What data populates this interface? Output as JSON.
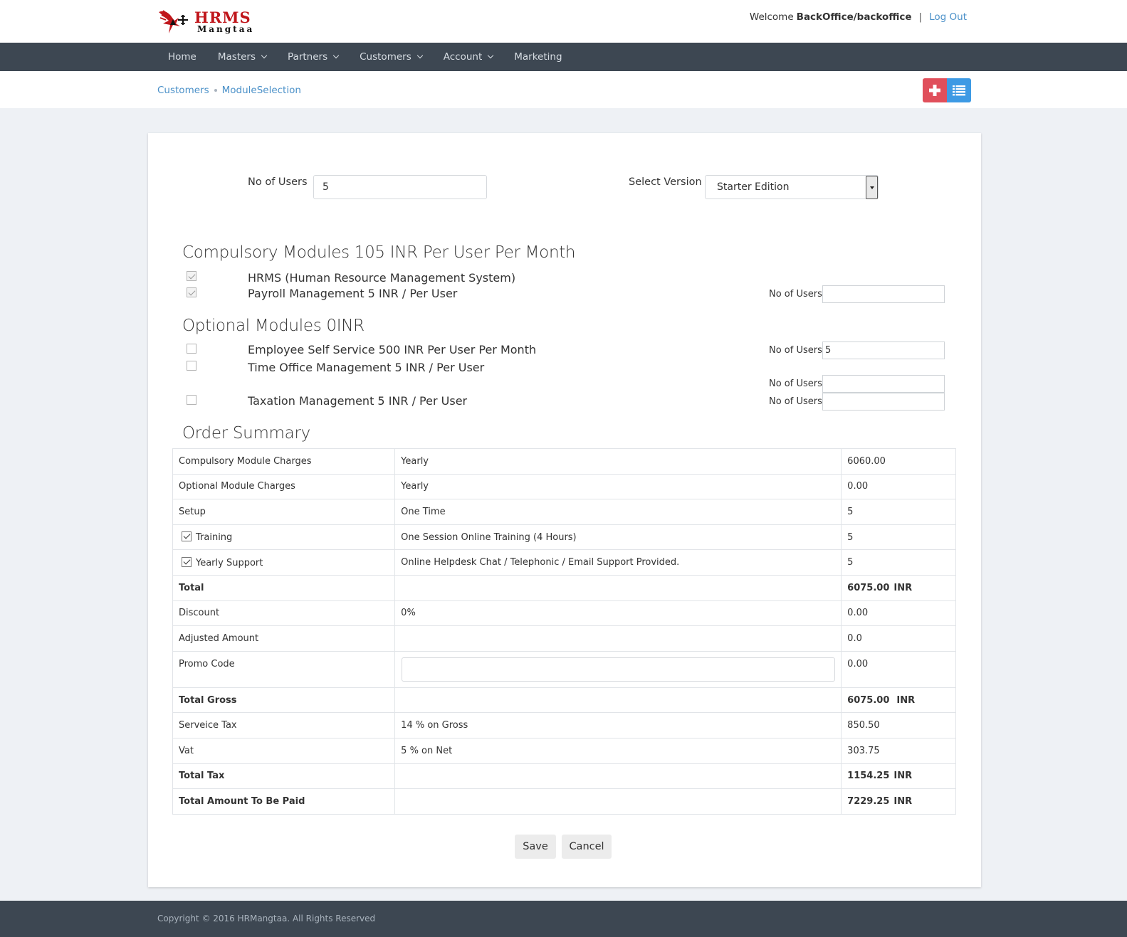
{
  "header": {
    "brand_top": "HRMS",
    "brand_bottom": "Mangtaa",
    "welcome_label": "Welcome",
    "username": "BackOffice/backoffice",
    "separator": "|",
    "logout": "Log Out"
  },
  "nav": {
    "items": [
      {
        "label": "Home"
      },
      {
        "label": "Masters"
      },
      {
        "label": "Partners"
      },
      {
        "label": "Customers"
      },
      {
        "label": "Account"
      },
      {
        "label": "Marketing"
      }
    ]
  },
  "breadcrumb": {
    "items": [
      "Customers",
      "ModuleSelection"
    ]
  },
  "form": {
    "users_label": "No of Users",
    "users_value": "5",
    "version_label": "Select Version",
    "version_value": "Starter Edition"
  },
  "compulsory": {
    "heading": "Compulsory Modules 105 INR Per User Per Month",
    "modules": [
      {
        "name": "HRMS (Human Resource Management System)",
        "checked": true
      },
      {
        "name": "Payroll Management 5 INR / Per User",
        "checked": true,
        "users_label": "No of Users",
        "users_value": ""
      }
    ]
  },
  "optional": {
    "heading": "Optional Modules 0INR",
    "modules": [
      {
        "name": "Employee Self Service 500 INR Per User Per Month",
        "checked": false,
        "users_label": "No of Users",
        "users_value": "5"
      },
      {
        "name": "Time Office Management 5 INR / Per User",
        "checked": false,
        "users_label": "No of Users",
        "users_value": ""
      },
      {
        "name": "Taxation Management 5 INR / Per User",
        "checked": false,
        "users_label": "No of Users",
        "users_value": ""
      }
    ]
  },
  "summary": {
    "heading": "Order Summary",
    "rows": [
      {
        "label": "Compulsory Module Charges",
        "detail": "Yearly",
        "amount": "6060.00"
      },
      {
        "label": "Optional Module Charges",
        "detail": "Yearly",
        "amount": "0.00"
      },
      {
        "label": "Setup",
        "detail": "One Time",
        "amount": "5"
      },
      {
        "label": "Training",
        "detail": "One Session Online Training (4 Hours)",
        "amount": "5"
      },
      {
        "label": "Yearly Support",
        "detail": "Online Helpdesk Chat / Telephonic / Email Support Provided.",
        "amount": "5"
      },
      {
        "label": "Total",
        "detail": "",
        "amount": "6075.00",
        "unit": "INR"
      },
      {
        "label": "Discount",
        "detail": "0%",
        "amount": "0.00"
      },
      {
        "label": "Adjusted Amount",
        "detail": "",
        "amount": "0.0"
      },
      {
        "label": "Promo Code",
        "detail": "",
        "amount": "0.00",
        "promo_value": ""
      },
      {
        "label": "Total Gross",
        "detail": "",
        "amount": "6075.00",
        "unit": "INR"
      },
      {
        "label": "Serveice Tax",
        "detail": "14 % on Gross",
        "amount": "850.50"
      },
      {
        "label": "Vat",
        "detail": "5 % on Net",
        "amount": "303.75"
      },
      {
        "label": "Total Tax",
        "detail": "",
        "amount": "1154.25",
        "unit": "INR"
      },
      {
        "label": "Total Amount To Be Paid",
        "detail": "",
        "amount": "7229.25",
        "unit": "INR"
      }
    ]
  },
  "actions": {
    "save": "Save",
    "cancel": "Cancel"
  },
  "footer": {
    "copyright": "Copyright © 2016 HRMangtaa. All Rights Reserved"
  },
  "colors": {
    "navbar": "#3d4752",
    "accent": "#4a90c8",
    "add_button": "#e04f5b",
    "list_button": "#3d9ae4",
    "brand_red": "#c0161b"
  },
  "icons": {
    "add": "plus-icon",
    "list": "list-icon",
    "dropdown": "chevron-down-icon"
  }
}
